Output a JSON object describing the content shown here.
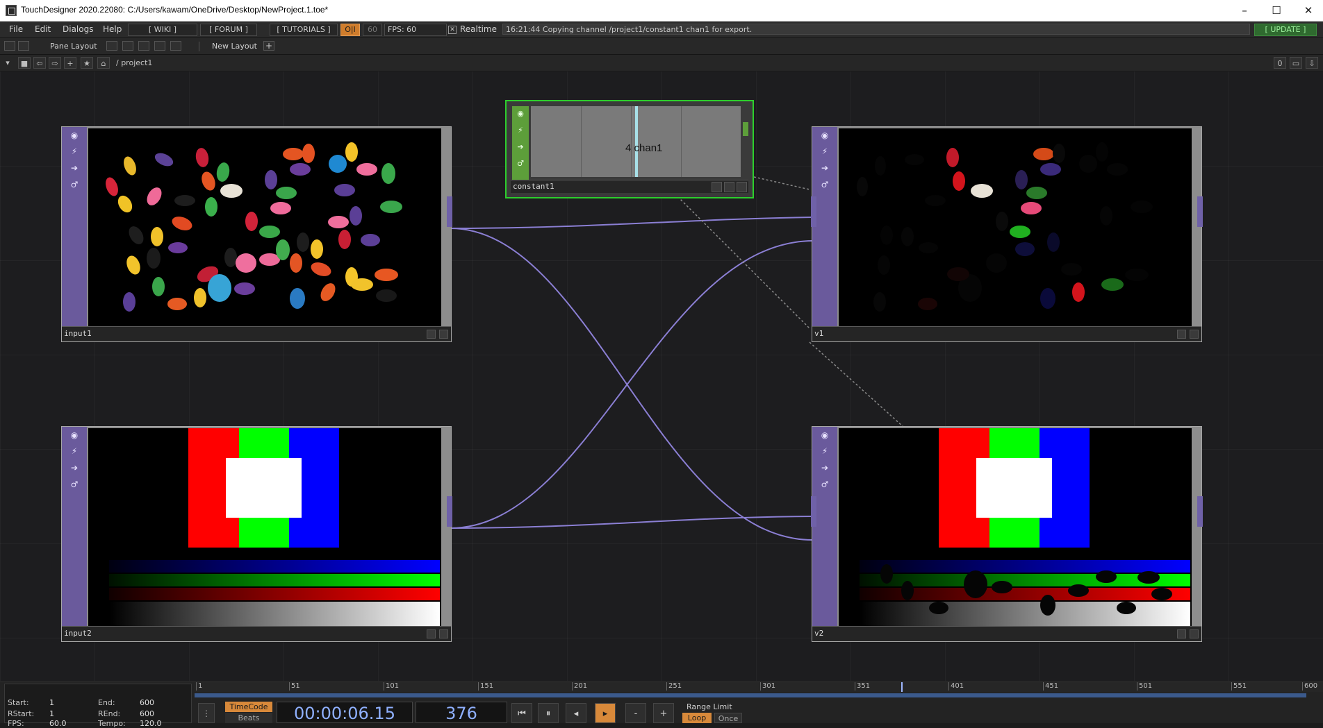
{
  "window": {
    "title": "TouchDesigner 2020.22080: C:/Users/kawam/OneDrive/Desktop/NewProject.1.toe*",
    "controls": [
      "–",
      "☐",
      "✕"
    ]
  },
  "menubar": {
    "items": [
      "File",
      "Edit",
      "Dialogs",
      "Help"
    ],
    "links": [
      "[ WIKI ]",
      "[ FORUM ]",
      "[ TUTORIALS ]"
    ],
    "oi_label": "O|I",
    "fps_cap": "60",
    "fps_label": "FPS: 60",
    "realtime_label": "Realtime",
    "status_message": "16:21:44 Copying channel /project1/constant1 chan1 for export.",
    "update_label": "[ UPDATE ]"
  },
  "panebar": {
    "pane_layout_label": "Pane Layout",
    "new_layout_label": "New Layout",
    "add_label": "+"
  },
  "pathbar": {
    "path": "/ project1",
    "counter": "0"
  },
  "nodes": {
    "input1": {
      "label": "input1"
    },
    "input2": {
      "label": "input2"
    },
    "v1": {
      "label": "v1"
    },
    "v2": {
      "label": "v2"
    },
    "constant1": {
      "label": "constant1",
      "value_text": "4 chan1"
    }
  },
  "timeline": {
    "ruler_ticks": [
      "1",
      "51",
      "101",
      "151",
      "201",
      "251",
      "301",
      "351",
      "401",
      "451",
      "501",
      "551",
      "600"
    ],
    "start_label": "Start:",
    "start_value": "1",
    "end_label": "End:",
    "end_value": "600",
    "rstart_label": "RStart:",
    "rstart_value": "1",
    "rend_label": "REnd:",
    "rend_value": "600",
    "fps_label": "FPS:",
    "fps_value": "60.0",
    "tempo_label": "Tempo:",
    "tempo_value": "120.0",
    "timecode_label": "TimeCode",
    "beats_label": "Beats",
    "timecode": "00:00:06.15",
    "frame": "376",
    "range_limit_label": "Range Limit",
    "loop_label": "Loop",
    "once_label": "Once",
    "minus_label": "-",
    "plus_label": "+"
  },
  "colors": {
    "accent_green": "#2ccf2c",
    "node_purple": "#6a5a9c",
    "wire_purple": "#8b7fd4",
    "playhead_orange": "#d8893a"
  }
}
